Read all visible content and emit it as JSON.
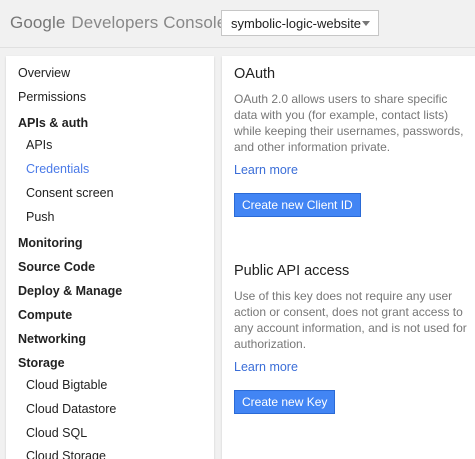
{
  "header": {
    "logo_brand": "Google",
    "logo_product": "Developers Console",
    "project_select": "symbolic-logic-website"
  },
  "sidebar": {
    "items": [
      {
        "label": "Overview"
      },
      {
        "label": "Permissions"
      },
      {
        "label": "APIs & auth"
      },
      {
        "label": "APIs"
      },
      {
        "label": "Credentials"
      },
      {
        "label": "Consent screen"
      },
      {
        "label": "Push"
      },
      {
        "label": "Monitoring"
      },
      {
        "label": "Source Code"
      },
      {
        "label": "Deploy & Manage"
      },
      {
        "label": "Compute"
      },
      {
        "label": "Networking"
      },
      {
        "label": "Storage"
      },
      {
        "label": "Cloud Bigtable"
      },
      {
        "label": "Cloud Datastore"
      },
      {
        "label": "Cloud SQL"
      },
      {
        "label": "Cloud Storage"
      }
    ],
    "active_item": "Credentials"
  },
  "oauth": {
    "title": "OAuth",
    "description": "OAuth 2.0 allows users to share specific data with you (for example, contact lists) while keeping their usernames, passwords, and other information private.",
    "learn_more": "Learn more",
    "button": "Create new Client ID"
  },
  "public_api": {
    "title": "Public API access",
    "description": "Use of this key does not require any user action or consent, does not grant access to any account information, and is not used for authorization.",
    "learn_more": "Learn more",
    "button": "Create new Key"
  },
  "colors": {
    "accent": "#4285f4",
    "link": "#3b6ed8",
    "active_nav": "#4a7ae8"
  }
}
